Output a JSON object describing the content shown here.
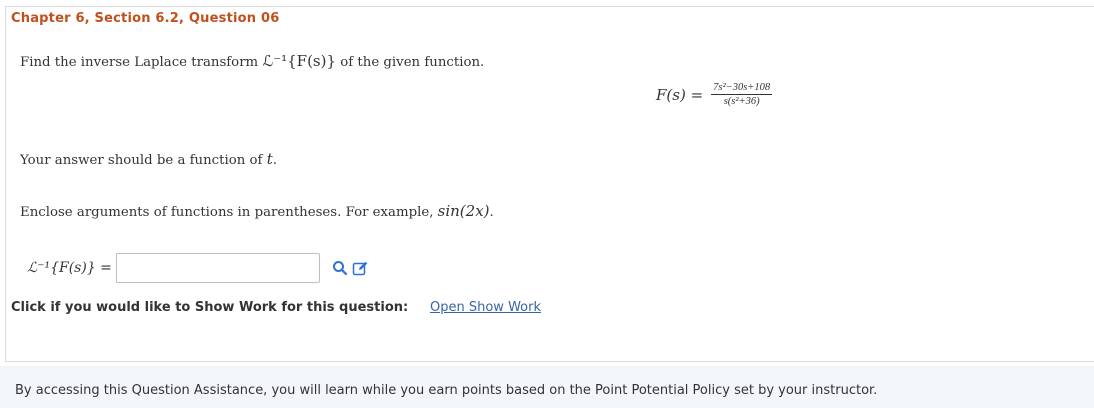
{
  "question": {
    "title": "Chapter 6, Section 6.2, Question 06",
    "prompt_text": "Find the inverse Laplace transform ",
    "prompt_math": "ℒ⁻¹{F(s)}",
    "prompt_suffix": " of the given function.",
    "function_lhs": "F(s) =",
    "function_numerator": "7s²−30s+108",
    "function_denominator": "s(s²+36)",
    "note_function_prefix": "Your answer should be a function of ",
    "note_function_var": "t",
    "note_function_suffix": ".",
    "note_args_prefix": "Enclose arguments of functions in parentheses. For example, ",
    "note_args_example": "sin(2x)",
    "note_args_suffix": "."
  },
  "answer": {
    "label": "ℒ⁻¹{F(s)} =",
    "value": "",
    "placeholder": ""
  },
  "icons": {
    "search": "magnifier-icon",
    "edit": "edit-icon",
    "color": "#2e6fd9"
  },
  "show_work": {
    "label": "Click if you would like to Show Work for this question:",
    "link": "Open Show Work"
  },
  "footer": {
    "text": "By accessing this Question Assistance, you will learn while you earn points based on the Point Potential Policy set by your instructor."
  }
}
